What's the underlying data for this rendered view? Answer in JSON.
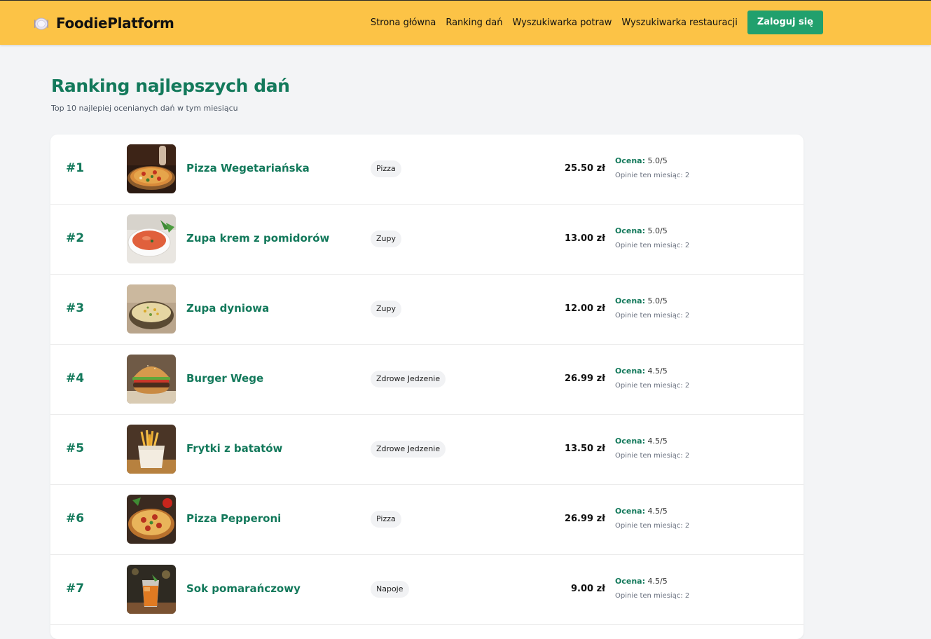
{
  "brand": {
    "name": "FoodiePlatform",
    "icon": "plate-icon"
  },
  "nav": {
    "links": [
      "Strona główna",
      "Ranking dań",
      "Wyszukiwarka potraw",
      "Wyszukiwarka restauracji"
    ],
    "login_label": "Zaloguj się"
  },
  "page": {
    "title": "Ranking najlepszych dań",
    "subtitle": "Top 10 najlepiej ocenianych dań w tym miesiącu"
  },
  "ranking": {
    "rating_label": "Ocena:",
    "items": [
      {
        "rank": "#1",
        "name": "Pizza Wegetariańska",
        "category": "Pizza",
        "price": "25.50 zł",
        "rating": "5.0/5",
        "reviews": "Opinie ten miesiąc: 2",
        "image": "pizza-veg-photo"
      },
      {
        "rank": "#2",
        "name": "Zupa krem z pomidorów",
        "category": "Zupy",
        "price": "13.00 zł",
        "rating": "5.0/5",
        "reviews": "Opinie ten miesiąc: 2",
        "image": "tomato-soup-photo"
      },
      {
        "rank": "#3",
        "name": "Zupa dyniowa",
        "category": "Zupy",
        "price": "12.00 zł",
        "rating": "5.0/5",
        "reviews": "Opinie ten miesiąc: 2",
        "image": "pumpkin-soup-photo"
      },
      {
        "rank": "#4",
        "name": "Burger Wege",
        "category": "Zdrowe Jedzenie",
        "price": "26.99 zł",
        "rating": "4.5/5",
        "reviews": "Opinie ten miesiąc: 2",
        "image": "burger-photo"
      },
      {
        "rank": "#5",
        "name": "Frytki z batatów",
        "category": "Zdrowe Jedzenie",
        "price": "13.50 zł",
        "rating": "4.5/5",
        "reviews": "Opinie ten miesiąc: 2",
        "image": "fries-photo"
      },
      {
        "rank": "#6",
        "name": "Pizza Pepperoni",
        "category": "Pizza",
        "price": "26.99 zł",
        "rating": "4.5/5",
        "reviews": "Opinie ten miesiąc: 2",
        "image": "pizza-pepperoni-photo"
      },
      {
        "rank": "#7",
        "name": "Sok pomarańczowy",
        "category": "Napoje",
        "price": "9.00 zł",
        "rating": "4.5/5",
        "reviews": "Opinie ten miesiąc: 2",
        "image": "juice-photo"
      }
    ]
  }
}
